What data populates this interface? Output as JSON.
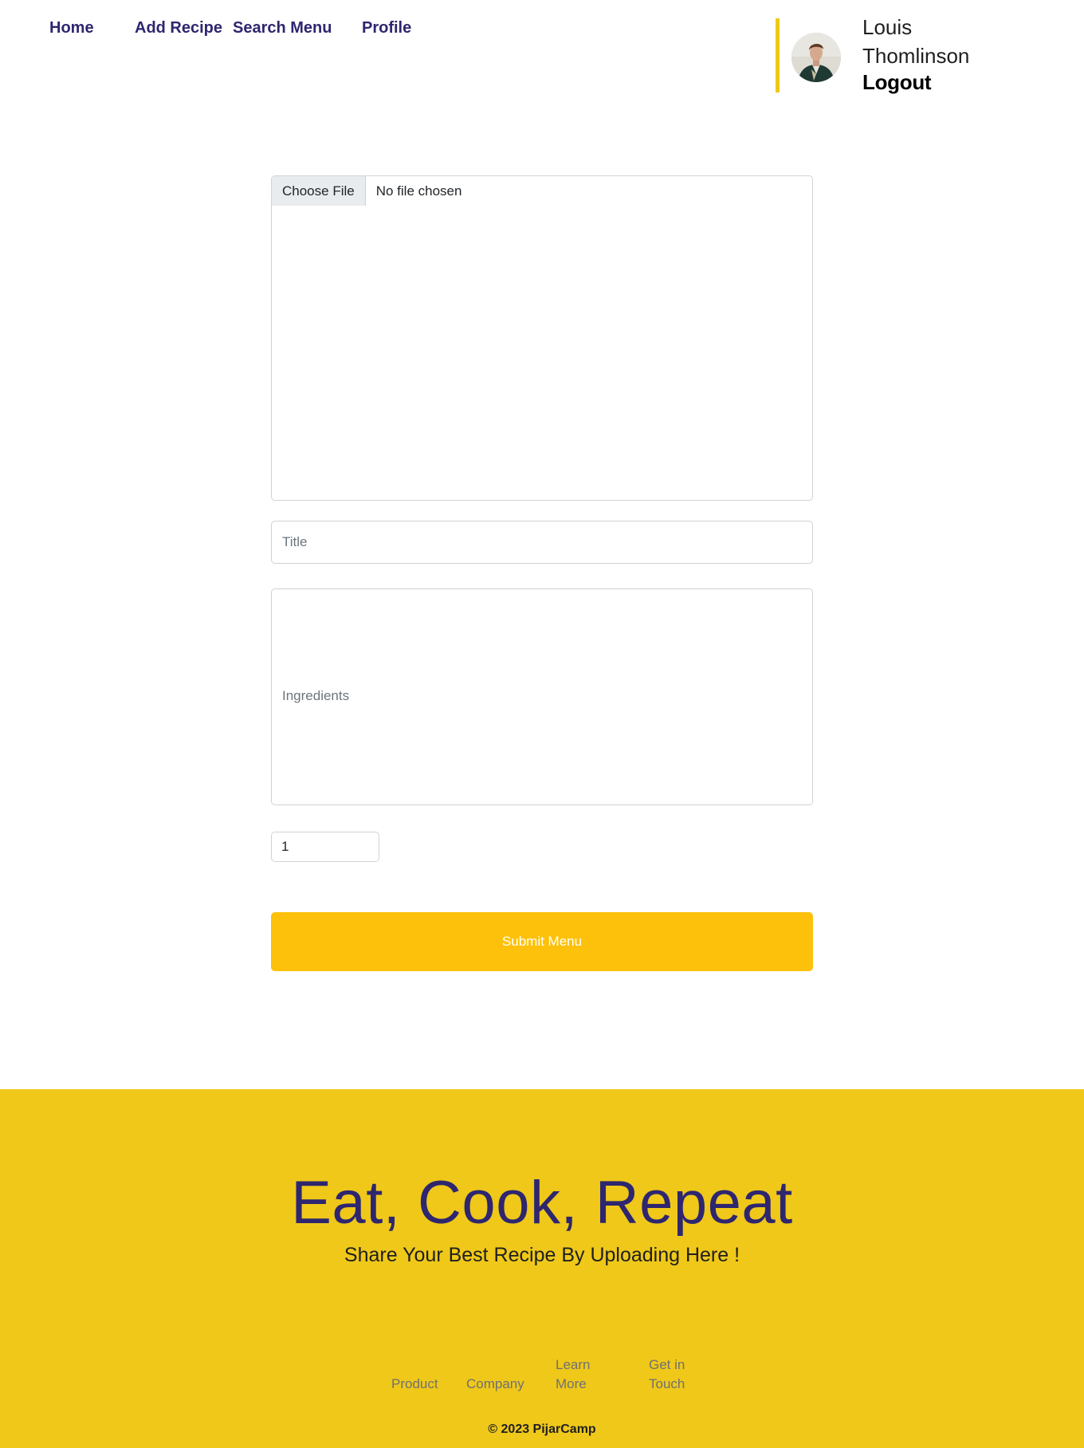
{
  "nav": {
    "home": "Home",
    "add_recipe": "Add Recipe",
    "search_menu": "Search Menu",
    "profile": "Profile"
  },
  "user": {
    "name": "Louis Thomlinson",
    "logout": "Logout",
    "avatar_icon": "user-avatar",
    "accent_color": "#efc81a"
  },
  "form": {
    "file_button": "Choose File",
    "file_status": "No file chosen",
    "title_placeholder": "Title",
    "title_value": "",
    "ingredients_placeholder": "Ingredients",
    "ingredients_value": "",
    "quantity_value": "1",
    "submit_label": "Submit Menu",
    "submit_color": "#fdc10b"
  },
  "footer": {
    "background_color": "#efc81a",
    "title": "Eat, Cook, Repeat",
    "subtitle": "Share Your Best Recipe By Uploading Here !",
    "links": {
      "product": "Product",
      "company": "Company",
      "learn_more": "Learn More",
      "get_in_touch": "Get in Touch"
    },
    "copyright": "© 2023 PijarCamp"
  }
}
